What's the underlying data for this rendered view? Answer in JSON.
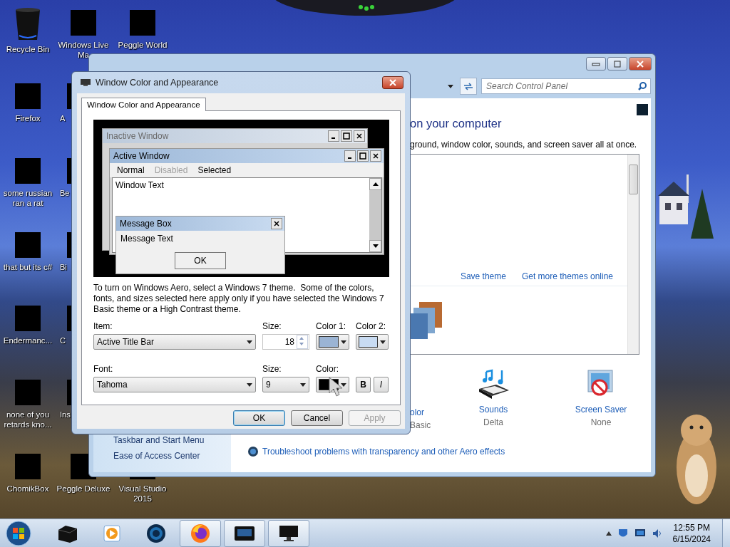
{
  "desktop": {
    "icons": [
      {
        "label": "Recycle Bin",
        "kind": "bin"
      },
      {
        "label": "Firefox",
        "kind": "hidden"
      },
      {
        "label": "some russian ran a rat",
        "kind": "hidden"
      },
      {
        "label": "that but its c#",
        "kind": "hidden"
      },
      {
        "label": "Endermanc...",
        "kind": "hidden"
      },
      {
        "label": "none of you retards kno...",
        "kind": "hidden"
      },
      {
        "label": "ChomikBox",
        "kind": "hidden"
      },
      {
        "label": "Windows Live Ma",
        "kind": "hidden"
      },
      {
        "label": "A",
        "kind": "hidden"
      },
      {
        "label": "Be",
        "kind": "hidden"
      },
      {
        "label": "Bi",
        "kind": "hidden"
      },
      {
        "label": "C",
        "kind": "hidden"
      },
      {
        "label": "Ins",
        "kind": "hidden"
      },
      {
        "label": "Peggle Deluxe",
        "kind": "hidden"
      },
      {
        "label": "Peggle World",
        "kind": "hidden"
      },
      {
        "label": "Visual Studio 2015",
        "kind": "hidden"
      }
    ]
  },
  "control_panel": {
    "search": {
      "placeholder": "Search Control Panel"
    },
    "heading": "on your computer",
    "description": "ground, window color, sounds, and screen saver all at once.",
    "theme_links": [
      "Save theme",
      "Get more themes online"
    ],
    "settings": [
      {
        "label": "olor",
        "value": "Basic",
        "kind": "color"
      },
      {
        "label": "Sounds",
        "value": "Delta",
        "kind": "sounds"
      },
      {
        "label": "Screen Saver",
        "value": "None",
        "kind": "screensaver"
      }
    ],
    "see_also": [
      "Taskbar and Start Menu",
      "Ease of Access Center"
    ],
    "troubleshoot_link": "Troubleshoot problems with transparency and other Aero effects"
  },
  "dialog": {
    "title": "Window Color and Appearance",
    "tabs": [
      {
        "label": "Window Color and Appearance",
        "selected": true
      }
    ],
    "preview": {
      "inactive_title": "Inactive Window",
      "active_title": "Active Window",
      "menu": [
        {
          "label": "Normal",
          "disabled": false
        },
        {
          "label": "Disabled",
          "disabled": true
        },
        {
          "label": "Selected",
          "disabled": false
        }
      ],
      "window_text": "Window Text",
      "message_title": "Message Box",
      "message_text": "Message Text",
      "message_button": "OK"
    },
    "note": "To turn on Windows Aero, select a Windows 7 theme.  Some of the colors, fonts, and sizes selected here apply only if you have selected the Windows 7 Basic theme or a High Contrast theme.",
    "item": {
      "label": "Item:",
      "value": "Active Title Bar"
    },
    "item_size": {
      "label": "Size:",
      "value": "18"
    },
    "color1": {
      "label": "Color 1:",
      "color": "#9bb4d4"
    },
    "color2": {
      "label": "Color 2:",
      "color": "#c8dbf2"
    },
    "font": {
      "label": "Font:",
      "value": "Tahoma"
    },
    "font_size": {
      "label": "Size:",
      "value": "9"
    },
    "font_color": {
      "label": "Color:",
      "color": "#000000"
    },
    "style_buttons": [
      {
        "label": "B",
        "kind": "bold"
      },
      {
        "label": "I",
        "kind": "italic"
      }
    ],
    "buttons": [
      {
        "label": "OK",
        "default": true,
        "disabled": false
      },
      {
        "label": "Cancel",
        "default": false,
        "disabled": false
      },
      {
        "label": "Apply",
        "default": false,
        "disabled": true
      }
    ]
  },
  "taskbar": {
    "apps": [
      {
        "kind": "box",
        "open": false
      },
      {
        "kind": "media",
        "open": false
      },
      {
        "kind": "globe",
        "open": false
      },
      {
        "kind": "firefox",
        "open": true
      },
      {
        "kind": "window",
        "open": true
      },
      {
        "kind": "monitor",
        "open": true
      }
    ],
    "clock": {
      "time": "12:55 PM",
      "date": "6/15/2024"
    }
  }
}
